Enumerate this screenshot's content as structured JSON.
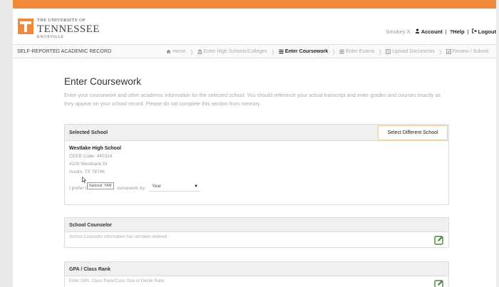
{
  "header": {
    "logo": {
      "line1": "THE UNIVERSITY OF",
      "line2": "TENNESSEE",
      "line3": "KNOXVILLE"
    },
    "user_name": "Smokey X.",
    "account_label": "Account",
    "help_label": "Help",
    "logout_label": "Logout"
  },
  "nav": {
    "title": "SELF-REPORTED ACADEMIC RECORD",
    "steps": [
      {
        "label": "Home",
        "icon": "home-icon",
        "active": false
      },
      {
        "label": "Enter High Schools/Colleges",
        "icon": "institution-icon",
        "active": false
      },
      {
        "label": "Enter Coursework",
        "icon": "list-icon",
        "active": true
      },
      {
        "label": "Enter Exams",
        "icon": "list-icon",
        "active": false
      },
      {
        "label": "Upload Documents",
        "icon": "document-icon",
        "active": false
      },
      {
        "label": "Review / Submit",
        "icon": "check-icon",
        "active": false
      }
    ]
  },
  "main": {
    "title": "Enter Coursework",
    "intro": "Enter your coursework and other academic information for the selected school. You should reference your actual transcript and enter grades and courses exactly as they appear on your school record. Please do not complete this section from memory."
  },
  "selected_school": {
    "heading": "Selected School",
    "button_label": "Select Different School",
    "name": "Westlake High School",
    "ceeb": "CEEB Code: 440324",
    "street": "4100 Westbank Dr",
    "city": "Austin, TX 78746",
    "prefer_prefix": "I prefer t",
    "prefer_suffix": "oursework by:",
    "tooltip": "National: YAM",
    "select_value": "Year"
  },
  "counselor": {
    "heading": "School Counselor",
    "note": "School Counselor information has not been entered"
  },
  "gpa": {
    "heading": "GPA / Class Rank",
    "note": "Enter GPA, Class Rank/Class Size or Decile Rank"
  },
  "colors": {
    "accent": "#f0893a",
    "edit_icon": "#4a8a3a"
  }
}
